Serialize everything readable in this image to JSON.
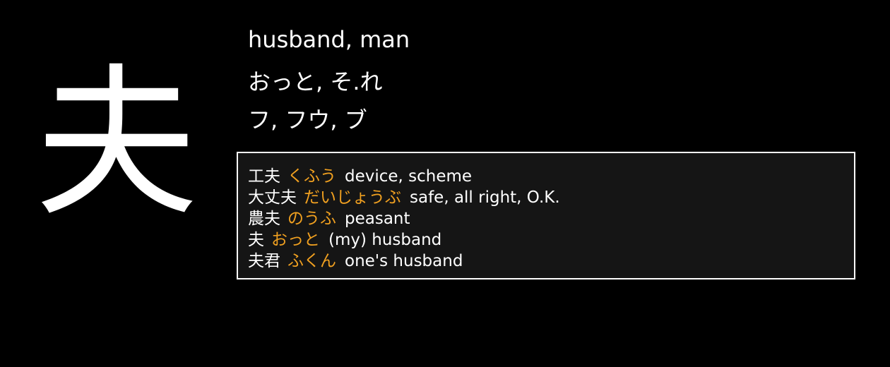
{
  "kanji": "夫",
  "meaning": "husband, man",
  "kun_readings": "おっと, そ.れ",
  "on_readings": "フ, フウ, ブ",
  "colors": {
    "background": "#000000",
    "text": "#ffffff",
    "reading": "#f0a020",
    "panel": "#151515",
    "panel_border": "#ffffff"
  },
  "examples": [
    {
      "word": "工夫",
      "reading": "くふう",
      "gloss": "device, scheme"
    },
    {
      "word": "大丈夫",
      "reading": "だいじょうぶ",
      "gloss": "safe, all right, O.K."
    },
    {
      "word": "農夫",
      "reading": "のうふ",
      "gloss": "peasant"
    },
    {
      "word": "夫",
      "reading": "おっと",
      "gloss": "(my) husband"
    },
    {
      "word": "夫君",
      "reading": "ふくん",
      "gloss": "one's husband"
    }
  ]
}
